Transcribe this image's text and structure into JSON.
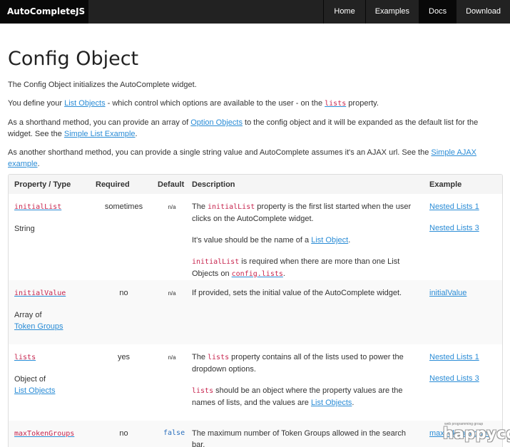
{
  "navbar": {
    "brand": "AutoCompleteJS",
    "links": [
      {
        "label": "Home"
      },
      {
        "label": "Examples"
      },
      {
        "label": "Docs"
      },
      {
        "label": "Download"
      }
    ]
  },
  "page": {
    "title": "Config Object",
    "p1": "The Config Object initializes the AutoComplete widget.",
    "p2_a": "You define your ",
    "p2_link": "List Objects",
    "p2_b": " - which control which options are available to the user - on the ",
    "p2_code": "lists",
    "p2_c": " property.",
    "p3_a": "As a shorthand method, you can provide an array of ",
    "p3_link1": "Option Objects",
    "p3_b": " to the config object and it will be expanded as the default list for the widget. See the ",
    "p3_link2": "Simple List Example",
    "p3_c": ".",
    "p4_a": "As another shorthand method, you can provide a single string value and AutoComplete assumes it's an AJAX url. See the ",
    "p4_link": "Simple AJAX example",
    "p4_b": "."
  },
  "table": {
    "headers": {
      "property": "Property / Type",
      "required": "Required",
      "default": "Default",
      "description": "Description",
      "example": "Example"
    },
    "rows": {
      "initialList": {
        "name": "initialList",
        "type": "String",
        "required": "sometimes",
        "default": "n/a",
        "d1_a": "The ",
        "d1_code": "initialList",
        "d1_b": " property is the first list started when the user clicks on the AutoComplete widget.",
        "d2_a": "It's value should be the name of a ",
        "d2_link": "List Object",
        "d2_b": ".",
        "d3_code": "initialList",
        "d3_a": " is required when there are more than one List Objects on ",
        "d3_link": "config.lists",
        "d3_b": ".",
        "ex1": "Nested Lists 1",
        "ex2": "Nested Lists 3"
      },
      "initialValue": {
        "name": "initialValue",
        "type_a": "Array of",
        "type_link": "Token Groups",
        "required": "no",
        "default": "n/a",
        "desc": "If provided, sets the initial value of the AutoComplete widget.",
        "ex1": "initialValue"
      },
      "lists": {
        "name": "lists",
        "type_a": "Object of",
        "type_link": "List Objects",
        "required": "yes",
        "default": "n/a",
        "d1_a": "The ",
        "d1_code": "lists",
        "d1_b": " property contains all of the lists used to power the dropdown options.",
        "d2_code": "lists",
        "d2_a": " should be an object where the property values are the names of lists, and the values are ",
        "d2_link": "List Objects",
        "d2_b": ".",
        "ex1": "Nested Lists 1",
        "ex2": "Nested Lists 3"
      },
      "maxTokenGroups": {
        "name": "maxTokenGroups",
        "required": "no",
        "default": "false",
        "desc": "The maximum number of Token Groups allowed in the search bar.",
        "ex1": "maxTokenGroups"
      }
    }
  },
  "watermark": {
    "sub": "web programming group",
    "main": "happycgi"
  }
}
